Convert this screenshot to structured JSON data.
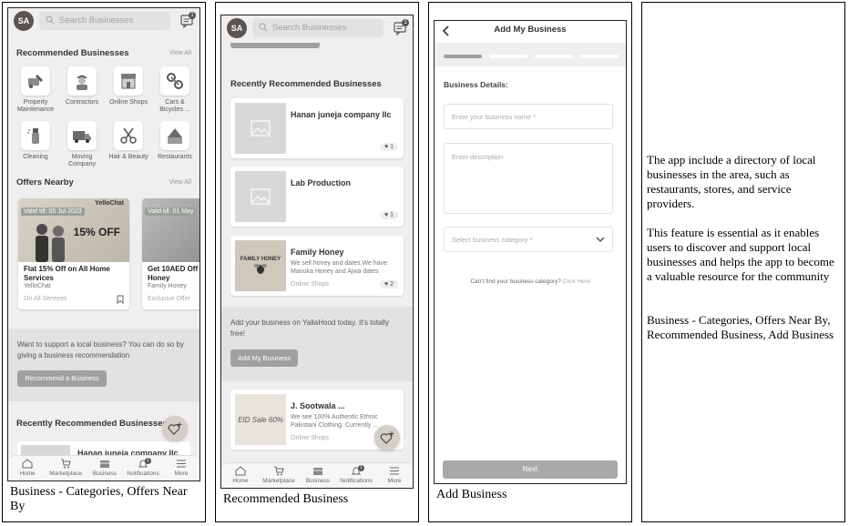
{
  "panel1": {
    "avatar": "SA",
    "search_placeholder": "Search Businesses",
    "msg_badge": "1",
    "recommended_title": "Recommended Businesses",
    "view_all": "View All",
    "categories": [
      {
        "label": "Property Maintenance",
        "icon": "tools-icon"
      },
      {
        "label": "Contractors",
        "icon": "worker-icon"
      },
      {
        "label": "Online Shops",
        "icon": "shop-icon"
      },
      {
        "label": "Cars & Bicycles ...",
        "icon": "car-icon"
      },
      {
        "label": "Cleaning",
        "icon": "spray-icon"
      },
      {
        "label": "Moving Company",
        "icon": "truck-icon"
      },
      {
        "label": "Hair & Beauty",
        "icon": "scissors-icon"
      },
      {
        "label": "Restaurants",
        "icon": "restaurant-icon"
      }
    ],
    "offers_title": "Offers Nearby",
    "offers_view_all": "View All",
    "offers": [
      {
        "valid": "Valid till: 05 Jul 2023",
        "title": "Flat 15% Off on All Home Services",
        "vendor": "YelloChat",
        "scope": "On All Services",
        "banner": "15% OFF",
        "brand": "YelloChat"
      },
      {
        "valid": "Valid till: 01 May",
        "title": "Get 10AED Off Honey",
        "vendor": "Family Honey",
        "scope": "Exclusive Offer"
      }
    ],
    "promo_text": "Want to support a local business? You can do so by giving a business recommendation",
    "promo_button": "Recommend a Business",
    "recent_title": "Recently Recommended Businesses",
    "recent_first": "Hanan juneja company llc",
    "nav": [
      "Home",
      "Marketplace",
      "Business",
      "Notifications",
      "More"
    ],
    "notif_badge": "1",
    "caption": "Business - Categories, Offers Near By"
  },
  "panel2": {
    "avatar": "SA",
    "search_placeholder": "Search Businesses",
    "msg_badge": "1",
    "section_title": "Recently Recommended Businesses",
    "businesses": [
      {
        "name": "Hanan juneja company llc",
        "desc": "",
        "category": "",
        "likes": "1"
      },
      {
        "name": "Lab Production",
        "desc": "",
        "category": "",
        "likes": "1"
      },
      {
        "name": "Family Honey",
        "desc": "We sell honey and dates.We have Manuka Honey and Ajwa dates",
        "category": "Online Shops",
        "likes": "2",
        "thumb_text": "FAMILY HONEY"
      },
      {
        "name": "J. Sootwala ...",
        "desc": "We see 100% Authentic Ethnic Pakistani Clothing. Currently ...",
        "category": "Online Shops",
        "likes": "",
        "thumb_text": "EID Sale 60%"
      }
    ],
    "promo_text": "Add your business on YallaHood today. It's totally free!",
    "promo_button": "Add My Business",
    "nav": [
      "Home",
      "Marketplace",
      "Business",
      "Notifications",
      "More"
    ],
    "notif_badge": "1",
    "caption": "Recommended Business"
  },
  "panel3": {
    "title": "Add My Business",
    "section": "Business Details:",
    "name_placeholder": "Enter your business name *",
    "desc_placeholder": "Enter description",
    "category_placeholder": "Select business category *",
    "cant_find": "Can't find your business category?",
    "click_here": "Click Here",
    "next_button": "Next",
    "caption": "Add Business"
  },
  "panel4": {
    "para1": "The app include a directory of local businesses in the area, such as restaurants, stores, and service providers.",
    "para2": "This feature is essential as it enables users to discover and support local businesses and helps the app to become a valuable resource for the community",
    "para3": "Business - Categories, Offers Near By, Recommended Business, Add Business"
  }
}
